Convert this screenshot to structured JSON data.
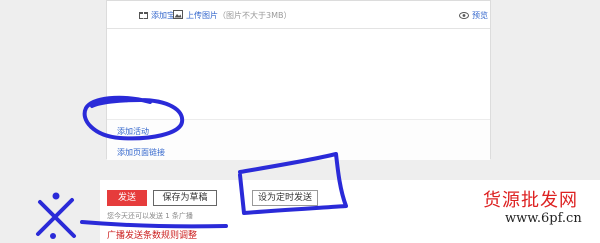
{
  "toolbar": {
    "add_item_label": "添加宝贝",
    "upload_image_label": "上传图片",
    "upload_image_note": "（图片不大于3MB）",
    "preview_label": "预览"
  },
  "links": {
    "add_activity": "添加活动",
    "add_page_link": "添加页面链接"
  },
  "actions": {
    "send_label": "发送",
    "save_draft_label": "保存为草稿",
    "scheduled_send_label": "设为定时发送"
  },
  "hint_text": "您今天还可以发送 1 条广播",
  "rules_link": "广播发送条数规则调整",
  "watermark": {
    "chinese": "货源批发网",
    "url": "www.6pf.cn"
  },
  "colors": {
    "accent_blue": "#3366cc",
    "send_red": "#e63c3c",
    "annotation_blue": "#2a2ad8"
  }
}
